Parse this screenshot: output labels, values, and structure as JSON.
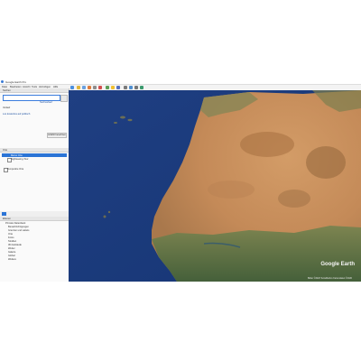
{
  "window": {
    "title": "Google Earth Pro"
  },
  "menu": [
    "Datei",
    "Bearbeiten",
    "Ansicht",
    "Tools",
    "Hinzufügen",
    "Hilfe"
  ],
  "sidebar": {
    "search_header": "Suchen",
    "search_placeholder": "",
    "search_links": [
      "Verlauf löschen",
      "Suchverlauf",
      "Verlauf"
    ],
    "search_result_label": "Los kostenlos auf politisch",
    "get_directions_button": "Anfahrt berechnen",
    "places_header": "Orte",
    "places_selected": "Meine Orte",
    "places_items": [
      "Sightseeing-Tour",
      "Temporäre Orte"
    ],
    "layers_header": "Ebenen",
    "layers_items": [
      "Primäre Datenbank",
      "Benachrichtigungen",
      "Grenzen und Labels",
      "Orte",
      "Fotos",
      "Straßen",
      "3D-Gebäude",
      "Wetter",
      "Galerie",
      "Global",
      "Weitere"
    ]
  },
  "map": {
    "logo": "Google Earth",
    "attribution": "Bilder ©2020 TerraMetrics   Kartendaten ©2020"
  },
  "colors": {
    "ocean": "#1d3f86",
    "sahara": "#c9915c",
    "sahel_green": "#5f7a3e",
    "selection": "#2b74d6"
  }
}
